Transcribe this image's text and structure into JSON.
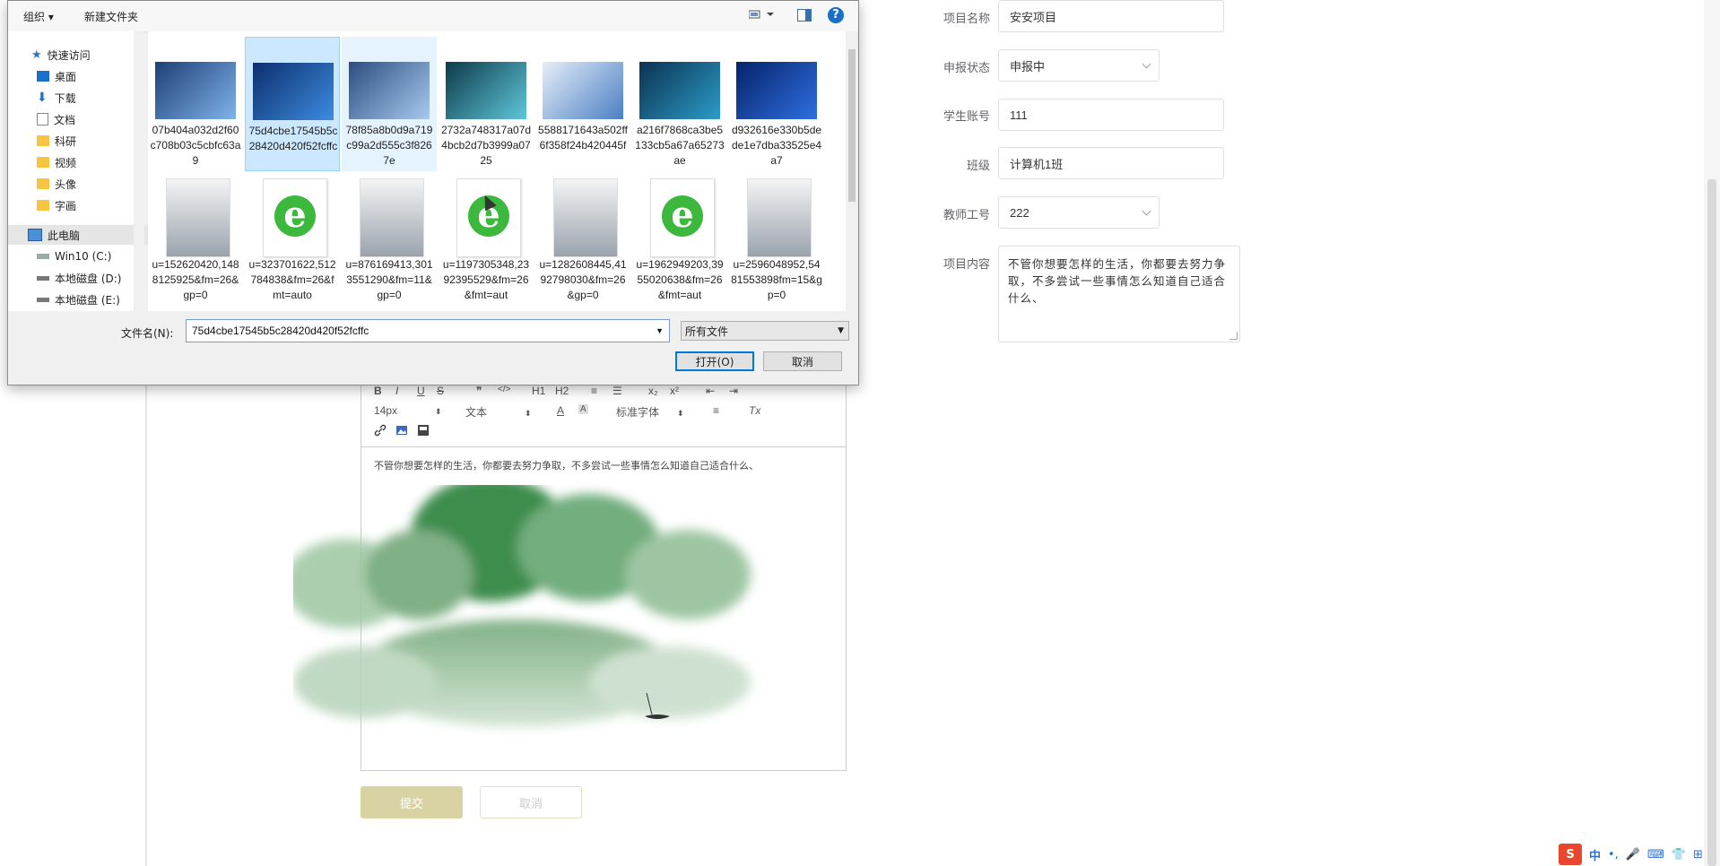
{
  "form": {
    "project_name": {
      "label": "项目名称",
      "value": "安安项目"
    },
    "status": {
      "label": "申报状态",
      "value": "申报中"
    },
    "student_account": {
      "label": "学生账号",
      "value": "111"
    },
    "class": {
      "label": "班级",
      "value": "计算机1班"
    },
    "teacher_id": {
      "label": "教师工号",
      "value": "222"
    },
    "content": {
      "label": "项目内容",
      "value": "不管你想要怎样的生活，你都要去努力争取，不多尝试一些事情怎么知道自己适合什么、"
    }
  },
  "editor": {
    "toolbar_row1": [
      "B",
      "I",
      "U",
      "S",
      "❞",
      "</>",
      "H1",
      "H2",
      "≡",
      "☰",
      "x₂",
      "x²",
      "⇤",
      "⇥"
    ],
    "font_size": "14px",
    "text_style": "文本",
    "font_color_label": "A",
    "bg_color_label": "A",
    "font_family": "标准字体",
    "align_label": "≡",
    "clear_label": "Tx",
    "body_text": "不管你想要怎样的生活，你都要去努力争取，不多尝试一些事情怎么知道自己适合什么、"
  },
  "page_buttons": {
    "submit": "提交",
    "cancel": "取消"
  },
  "dialog": {
    "toolbar": {
      "organize": "组织 ▾",
      "new_folder": "新建文件夹",
      "help": "?"
    },
    "nav": [
      {
        "label": "快速访问",
        "icon": "star-icon"
      },
      {
        "label": "桌面",
        "icon": "desktop-icon",
        "pinned": true
      },
      {
        "label": "下载",
        "icon": "download-icon",
        "pinned": true
      },
      {
        "label": "文档",
        "icon": "document-icon",
        "pinned": true
      },
      {
        "label": "科研",
        "icon": "folder-icon"
      },
      {
        "label": "视频",
        "icon": "folder-icon"
      },
      {
        "label": "头像",
        "icon": "folder-icon"
      },
      {
        "label": "字画",
        "icon": "folder-icon"
      },
      {
        "label": "此电脑",
        "icon": "computer-icon"
      },
      {
        "label": "Win10 (C:)",
        "icon": "drive-icon"
      },
      {
        "label": "本地磁盘 (D:)",
        "icon": "drive-icon"
      },
      {
        "label": "本地磁盘 (E:)",
        "icon": "drive-icon"
      }
    ],
    "files": [
      {
        "name": "07b404a032d2f60c708b03c5cbfc63a9",
        "kind": "image"
      },
      {
        "name": "75d4cbe17545b5c28420d420f52fcffc",
        "kind": "image",
        "selected": true
      },
      {
        "name": "78f85a8b0d9a719c99a2d555c3f8267e",
        "kind": "image"
      },
      {
        "name": "2732a748317a07d4bcb2d7b3999a0725",
        "kind": "image"
      },
      {
        "name": "5588171643a502ff6f358f24b420445f",
        "kind": "image"
      },
      {
        "name": "a216f7868ca3be5133cb5a67a65273ae",
        "kind": "image"
      },
      {
        "name": "d932616e330b5dede1e7dba33525e4a7",
        "kind": "image"
      },
      {
        "name": "u=152620420,1488125925&fm=26&gp=0",
        "kind": "image"
      },
      {
        "name": "u=323701622,512784838&fm=26&fmt=auto",
        "kind": "ie"
      },
      {
        "name": "u=876169413,3013551290&fm=11&gp=0",
        "kind": "image"
      },
      {
        "name": "u=1197305348,2392395529&fm=26&fmt=aut",
        "kind": "ie"
      },
      {
        "name": "u=1282608445,4192798030&fm=26&gp=0",
        "kind": "image"
      },
      {
        "name": "u=1962949203,3955020638&fm=26&fmt=aut",
        "kind": "ie"
      },
      {
        "name": "u=2596048952,5481553898fm=15&gp=0",
        "kind": "image"
      }
    ],
    "filename_label": "文件名(N):",
    "filename_value": "75d4cbe17545b5c28420d420f52fcffc",
    "filetype": "所有文件",
    "open_button": "打开(O)",
    "cancel_button": "取消"
  },
  "tray": {
    "ime": "中",
    "punct": "•,"
  }
}
